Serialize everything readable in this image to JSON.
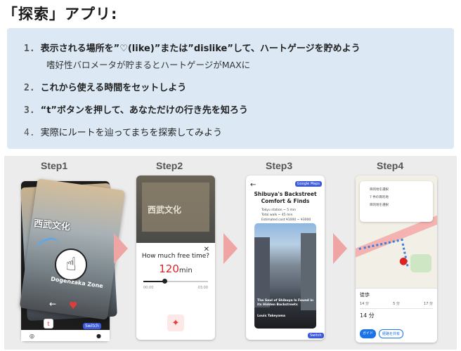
{
  "title": "「探索」アプリ:",
  "steps": [
    {
      "num": "1.",
      "text": "表示される場所を”♡(like)”または”dislike”して、ハートゲージを貯めよう",
      "sub": "嗜好性バロメータが貯まるとハートゲージがMAXに"
    },
    {
      "num": "2.",
      "text": "これから使える時間をセットしよう"
    },
    {
      "num": "3.",
      "text": "“t”ボタンを押して、あなただけの行き先を知ろう"
    },
    {
      "num": "4.",
      "text": "実際にルートを辿ってまちを探索してみよう"
    }
  ],
  "gallery": {
    "labels": [
      "Step1",
      "Step2",
      "Step3",
      "Step4"
    ],
    "step1": {
      "sign": "西武文化",
      "caption": "Dogenzaka Zone",
      "badge": "t"
    },
    "step2": {
      "question": "How much free time?",
      "minutes": "120",
      "unit": "min",
      "ticks": [
        "00:00",
        "03:00"
      ]
    },
    "step3": {
      "gmaps": "Google Maps",
      "title": "Shibuya's Backstreet Comfort & Finds",
      "info": [
        "Tokyu station ~ 5 min",
        "Total walk ~ 45 min",
        "Estimated cost ¥1000 ~ ¥3000"
      ],
      "caption": "The Soul of Shibuya Is Found in its Hidden Backstreets",
      "author": "Louis Takeyama",
      "switch": "Switch"
    },
    "step4": {
      "destinations": [
        "目的地を選択",
        "7 件の目的地",
        "目的地を選択"
      ],
      "tab": "徒歩",
      "modes": [
        "14 分",
        "5 分",
        "17 分"
      ],
      "time": "14 分",
      "go": "ガイド",
      "alt": "経路を共有"
    }
  }
}
